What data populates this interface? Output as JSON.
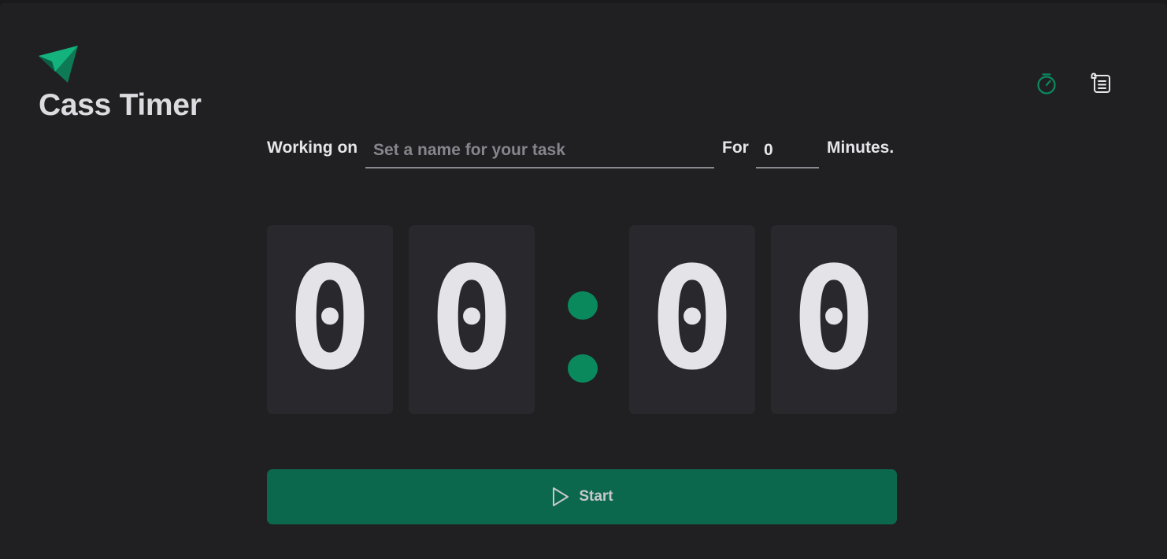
{
  "app": {
    "title": "Cass Timer",
    "accent": "#0a8a5c",
    "logo_icon": "paper-plane-icon"
  },
  "nav": {
    "timer_icon": "stopwatch-icon",
    "log_icon": "scroll-list-icon"
  },
  "task": {
    "working_on_label": "Working on",
    "name_placeholder": "Set a name for your task",
    "name_value": "",
    "for_label": "For",
    "minutes_value": "0",
    "minutes_label": "Minutes."
  },
  "clock": {
    "minutes_tens": "0",
    "minutes_ones": "0",
    "seconds_tens": "0",
    "seconds_ones": "0"
  },
  "start_button": {
    "label": "Start",
    "icon": "play-icon"
  }
}
